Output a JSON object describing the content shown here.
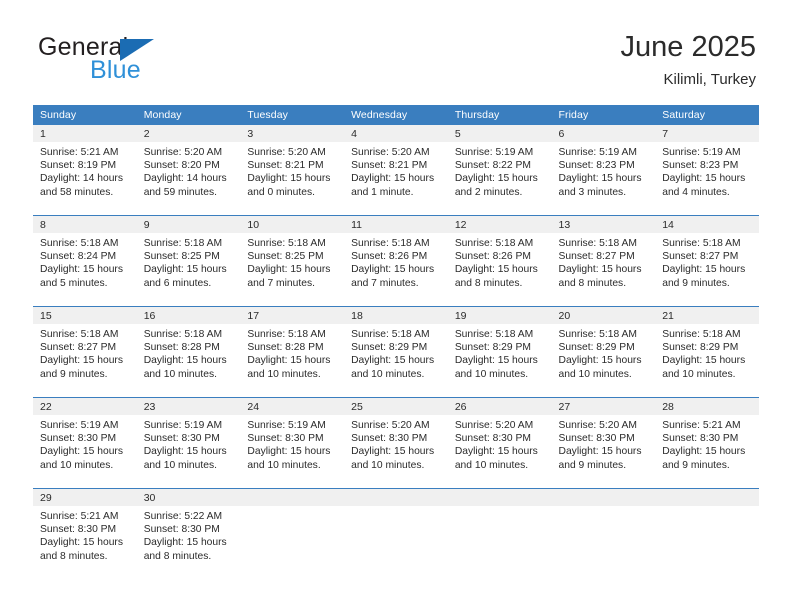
{
  "logo": {
    "line1": "General",
    "line2": "Blue",
    "triangle_color": "#1b6cb3",
    "line1_color": "#231f20",
    "line2_color": "#2f90d8"
  },
  "header": {
    "title": "June 2025",
    "location": "Kilimli, Turkey"
  },
  "theme": {
    "header_bg": "#3a7ebf",
    "header_text": "#ffffff",
    "daynum_bg": "#f0f0f0",
    "text": "#2b2b2b",
    "row_border": "#3a7ebf"
  },
  "weekday_headers": [
    "Sunday",
    "Monday",
    "Tuesday",
    "Wednesday",
    "Thursday",
    "Friday",
    "Saturday"
  ],
  "weeks": [
    [
      {
        "day": "1",
        "sunrise": "Sunrise: 5:21 AM",
        "sunset": "Sunset: 8:19 PM",
        "daylight1": "Daylight: 14 hours",
        "daylight2": "and 58 minutes."
      },
      {
        "day": "2",
        "sunrise": "Sunrise: 5:20 AM",
        "sunset": "Sunset: 8:20 PM",
        "daylight1": "Daylight: 14 hours",
        "daylight2": "and 59 minutes."
      },
      {
        "day": "3",
        "sunrise": "Sunrise: 5:20 AM",
        "sunset": "Sunset: 8:21 PM",
        "daylight1": "Daylight: 15 hours",
        "daylight2": "and 0 minutes."
      },
      {
        "day": "4",
        "sunrise": "Sunrise: 5:20 AM",
        "sunset": "Sunset: 8:21 PM",
        "daylight1": "Daylight: 15 hours",
        "daylight2": "and 1 minute."
      },
      {
        "day": "5",
        "sunrise": "Sunrise: 5:19 AM",
        "sunset": "Sunset: 8:22 PM",
        "daylight1": "Daylight: 15 hours",
        "daylight2": "and 2 minutes."
      },
      {
        "day": "6",
        "sunrise": "Sunrise: 5:19 AM",
        "sunset": "Sunset: 8:23 PM",
        "daylight1": "Daylight: 15 hours",
        "daylight2": "and 3 minutes."
      },
      {
        "day": "7",
        "sunrise": "Sunrise: 5:19 AM",
        "sunset": "Sunset: 8:23 PM",
        "daylight1": "Daylight: 15 hours",
        "daylight2": "and 4 minutes."
      }
    ],
    [
      {
        "day": "8",
        "sunrise": "Sunrise: 5:18 AM",
        "sunset": "Sunset: 8:24 PM",
        "daylight1": "Daylight: 15 hours",
        "daylight2": "and 5 minutes."
      },
      {
        "day": "9",
        "sunrise": "Sunrise: 5:18 AM",
        "sunset": "Sunset: 8:25 PM",
        "daylight1": "Daylight: 15 hours",
        "daylight2": "and 6 minutes."
      },
      {
        "day": "10",
        "sunrise": "Sunrise: 5:18 AM",
        "sunset": "Sunset: 8:25 PM",
        "daylight1": "Daylight: 15 hours",
        "daylight2": "and 7 minutes."
      },
      {
        "day": "11",
        "sunrise": "Sunrise: 5:18 AM",
        "sunset": "Sunset: 8:26 PM",
        "daylight1": "Daylight: 15 hours",
        "daylight2": "and 7 minutes."
      },
      {
        "day": "12",
        "sunrise": "Sunrise: 5:18 AM",
        "sunset": "Sunset: 8:26 PM",
        "daylight1": "Daylight: 15 hours",
        "daylight2": "and 8 minutes."
      },
      {
        "day": "13",
        "sunrise": "Sunrise: 5:18 AM",
        "sunset": "Sunset: 8:27 PM",
        "daylight1": "Daylight: 15 hours",
        "daylight2": "and 8 minutes."
      },
      {
        "day": "14",
        "sunrise": "Sunrise: 5:18 AM",
        "sunset": "Sunset: 8:27 PM",
        "daylight1": "Daylight: 15 hours",
        "daylight2": "and 9 minutes."
      }
    ],
    [
      {
        "day": "15",
        "sunrise": "Sunrise: 5:18 AM",
        "sunset": "Sunset: 8:27 PM",
        "daylight1": "Daylight: 15 hours",
        "daylight2": "and 9 minutes."
      },
      {
        "day": "16",
        "sunrise": "Sunrise: 5:18 AM",
        "sunset": "Sunset: 8:28 PM",
        "daylight1": "Daylight: 15 hours",
        "daylight2": "and 10 minutes."
      },
      {
        "day": "17",
        "sunrise": "Sunrise: 5:18 AM",
        "sunset": "Sunset: 8:28 PM",
        "daylight1": "Daylight: 15 hours",
        "daylight2": "and 10 minutes."
      },
      {
        "day": "18",
        "sunrise": "Sunrise: 5:18 AM",
        "sunset": "Sunset: 8:29 PM",
        "daylight1": "Daylight: 15 hours",
        "daylight2": "and 10 minutes."
      },
      {
        "day": "19",
        "sunrise": "Sunrise: 5:18 AM",
        "sunset": "Sunset: 8:29 PM",
        "daylight1": "Daylight: 15 hours",
        "daylight2": "and 10 minutes."
      },
      {
        "day": "20",
        "sunrise": "Sunrise: 5:18 AM",
        "sunset": "Sunset: 8:29 PM",
        "daylight1": "Daylight: 15 hours",
        "daylight2": "and 10 minutes."
      },
      {
        "day": "21",
        "sunrise": "Sunrise: 5:18 AM",
        "sunset": "Sunset: 8:29 PM",
        "daylight1": "Daylight: 15 hours",
        "daylight2": "and 10 minutes."
      }
    ],
    [
      {
        "day": "22",
        "sunrise": "Sunrise: 5:19 AM",
        "sunset": "Sunset: 8:30 PM",
        "daylight1": "Daylight: 15 hours",
        "daylight2": "and 10 minutes."
      },
      {
        "day": "23",
        "sunrise": "Sunrise: 5:19 AM",
        "sunset": "Sunset: 8:30 PM",
        "daylight1": "Daylight: 15 hours",
        "daylight2": "and 10 minutes."
      },
      {
        "day": "24",
        "sunrise": "Sunrise: 5:19 AM",
        "sunset": "Sunset: 8:30 PM",
        "daylight1": "Daylight: 15 hours",
        "daylight2": "and 10 minutes."
      },
      {
        "day": "25",
        "sunrise": "Sunrise: 5:20 AM",
        "sunset": "Sunset: 8:30 PM",
        "daylight1": "Daylight: 15 hours",
        "daylight2": "and 10 minutes."
      },
      {
        "day": "26",
        "sunrise": "Sunrise: 5:20 AM",
        "sunset": "Sunset: 8:30 PM",
        "daylight1": "Daylight: 15 hours",
        "daylight2": "and 10 minutes."
      },
      {
        "day": "27",
        "sunrise": "Sunrise: 5:20 AM",
        "sunset": "Sunset: 8:30 PM",
        "daylight1": "Daylight: 15 hours",
        "daylight2": "and 9 minutes."
      },
      {
        "day": "28",
        "sunrise": "Sunrise: 5:21 AM",
        "sunset": "Sunset: 8:30 PM",
        "daylight1": "Daylight: 15 hours",
        "daylight2": "and 9 minutes."
      }
    ],
    [
      {
        "day": "29",
        "sunrise": "Sunrise: 5:21 AM",
        "sunset": "Sunset: 8:30 PM",
        "daylight1": "Daylight: 15 hours",
        "daylight2": "and 8 minutes."
      },
      {
        "day": "30",
        "sunrise": "Sunrise: 5:22 AM",
        "sunset": "Sunset: 8:30 PM",
        "daylight1": "Daylight: 15 hours",
        "daylight2": "and 8 minutes."
      },
      {
        "day": "",
        "sunrise": "",
        "sunset": "",
        "daylight1": "",
        "daylight2": ""
      },
      {
        "day": "",
        "sunrise": "",
        "sunset": "",
        "daylight1": "",
        "daylight2": ""
      },
      {
        "day": "",
        "sunrise": "",
        "sunset": "",
        "daylight1": "",
        "daylight2": ""
      },
      {
        "day": "",
        "sunrise": "",
        "sunset": "",
        "daylight1": "",
        "daylight2": ""
      },
      {
        "day": "",
        "sunrise": "",
        "sunset": "",
        "daylight1": "",
        "daylight2": ""
      }
    ]
  ]
}
